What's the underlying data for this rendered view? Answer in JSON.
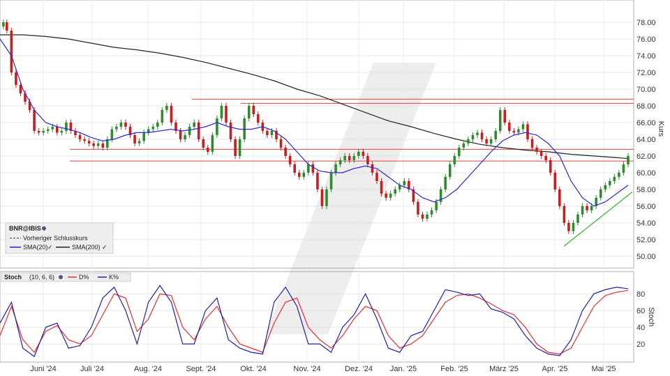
{
  "chart_data": [
    {
      "type": "candlestick",
      "symbol": "BNR@IBIS",
      "ylabel": "Kurs",
      "ylim": [
        49,
        80
      ],
      "y_ticks": [
        "78.00",
        "76.00",
        "74.00",
        "72.00",
        "70.00",
        "68.00",
        "66.00",
        "64.00",
        "62.00",
        "60.00",
        "58.00",
        "56.00",
        "54.00",
        "52.00",
        "50.00"
      ],
      "x_ticks": [
        "Juni '24",
        "Juli '24",
        "Aug. '24",
        "Sept. '24",
        "Okt. '24",
        "Nov. '24",
        "Dez. '24",
        "Jan. '25",
        "Feb. '25",
        "März '25",
        "Apr. '25",
        "Mai '25"
      ],
      "legend": {
        "symbol": "BNR@IBIS",
        "prev_close": "Vorheriger Schlusskurs",
        "sma20": "SMA(20)",
        "sma200": "SMA(200)"
      },
      "close_path": [
        [
          0,
          77.5
        ],
        [
          3,
          78
        ],
        [
          6,
          77
        ],
        [
          10,
          72
        ],
        [
          14,
          70.5
        ],
        [
          18,
          69.5
        ],
        [
          22,
          68.5
        ],
        [
          26,
          67.5
        ],
        [
          30,
          65
        ],
        [
          34,
          64.8
        ],
        [
          38,
          65
        ],
        [
          42,
          65.2
        ],
        [
          46,
          65.5
        ],
        [
          50,
          64.8
        ],
        [
          54,
          65
        ],
        [
          58,
          66
        ],
        [
          62,
          65
        ],
        [
          66,
          64.5
        ],
        [
          70,
          64
        ],
        [
          74,
          63.8
        ],
        [
          78,
          63.5
        ],
        [
          82,
          63.2
        ],
        [
          86,
          63.5
        ],
        [
          90,
          63
        ],
        [
          94,
          64
        ],
        [
          98,
          65.2
        ],
        [
          102,
          65.5
        ],
        [
          106,
          66
        ],
        [
          110,
          65.5
        ],
        [
          114,
          64.5
        ],
        [
          118,
          63.5
        ],
        [
          122,
          63.8
        ],
        [
          126,
          64.8
        ],
        [
          130,
          65.2
        ],
        [
          134,
          65.5
        ],
        [
          138,
          66
        ],
        [
          142,
          67.5
        ],
        [
          146,
          68
        ],
        [
          150,
          66
        ],
        [
          154,
          65
        ],
        [
          158,
          64
        ],
        [
          162,
          64.5
        ],
        [
          166,
          65.5
        ],
        [
          170,
          66
        ],
        [
          174,
          64
        ],
        [
          178,
          63
        ],
        [
          182,
          62.5
        ],
        [
          186,
          64.5
        ],
        [
          190,
          66.5
        ],
        [
          194,
          68
        ],
        [
          198,
          66
        ],
        [
          202,
          64
        ],
        [
          206,
          62
        ],
        [
          210,
          64
        ],
        [
          214,
          66.5
        ],
        [
          218,
          68
        ],
        [
          222,
          67
        ],
        [
          226,
          66
        ],
        [
          230,
          65
        ],
        [
          234,
          64.5
        ],
        [
          238,
          65
        ],
        [
          242,
          64
        ],
        [
          246,
          63
        ],
        [
          250,
          62
        ],
        [
          254,
          61
        ],
        [
          258,
          60
        ],
        [
          262,
          59.5
        ],
        [
          266,
          60
        ],
        [
          270,
          61
        ],
        [
          274,
          60
        ],
        [
          278,
          58
        ],
        [
          282,
          56
        ],
        [
          286,
          58
        ],
        [
          290,
          60
        ],
        [
          294,
          61
        ],
        [
          298,
          61.5
        ],
        [
          302,
          62
        ],
        [
          306,
          61.5
        ],
        [
          310,
          62
        ],
        [
          314,
          62.5
        ],
        [
          318,
          62
        ],
        [
          322,
          61
        ],
        [
          326,
          60
        ],
        [
          330,
          59
        ],
        [
          334,
          57.5
        ],
        [
          338,
          57
        ],
        [
          342,
          57.5
        ],
        [
          346,
          58
        ],
        [
          350,
          58.5
        ],
        [
          354,
          59
        ],
        [
          358,
          58
        ],
        [
          362,
          56.5
        ],
        [
          366,
          55
        ],
        [
          370,
          54.5
        ],
        [
          374,
          55
        ],
        [
          378,
          55.5
        ],
        [
          382,
          56.5
        ],
        [
          386,
          58
        ],
        [
          390,
          59.5
        ],
        [
          394,
          61
        ],
        [
          398,
          62
        ],
        [
          402,
          63
        ],
        [
          406,
          63.5
        ],
        [
          410,
          64
        ],
        [
          414,
          64.5
        ],
        [
          418,
          64.8
        ],
        [
          422,
          64
        ],
        [
          426,
          63.5
        ],
        [
          430,
          64
        ],
        [
          434,
          65
        ],
        [
          438,
          67.5
        ],
        [
          442,
          66
        ],
        [
          446,
          65
        ],
        [
          450,
          64.8
        ],
        [
          454,
          65.2
        ],
        [
          458,
          65.8
        ],
        [
          462,
          64
        ],
        [
          466,
          63
        ],
        [
          470,
          62.5
        ],
        [
          474,
          62
        ],
        [
          478,
          61.5
        ],
        [
          482,
          60
        ],
        [
          486,
          58
        ],
        [
          490,
          56
        ],
        [
          494,
          54
        ],
        [
          498,
          53
        ],
        [
          502,
          54
        ],
        [
          506,
          55
        ],
        [
          510,
          56
        ],
        [
          514,
          55.5
        ],
        [
          518,
          56
        ],
        [
          522,
          57
        ],
        [
          526,
          58
        ],
        [
          530,
          58.5
        ],
        [
          534,
          59
        ],
        [
          538,
          59.5
        ],
        [
          542,
          60
        ],
        [
          546,
          61
        ],
        [
          550,
          62
        ]
      ],
      "sma20": [
        [
          0,
          76
        ],
        [
          10,
          74
        ],
        [
          20,
          70
        ],
        [
          30,
          67.5
        ],
        [
          40,
          66
        ],
        [
          50,
          65.5
        ],
        [
          60,
          65.2
        ],
        [
          70,
          64.8
        ],
        [
          80,
          64.2
        ],
        [
          90,
          63.8
        ],
        [
          100,
          64
        ],
        [
          110,
          64.5
        ],
        [
          120,
          64.8
        ],
        [
          130,
          64.8
        ],
        [
          140,
          65
        ],
        [
          150,
          65.2
        ],
        [
          160,
          65
        ],
        [
          170,
          65.2
        ],
        [
          180,
          65.5
        ],
        [
          190,
          66
        ],
        [
          200,
          65.5
        ],
        [
          210,
          65.2
        ],
        [
          220,
          65.2
        ],
        [
          230,
          65.5
        ],
        [
          240,
          65
        ],
        [
          250,
          64
        ],
        [
          260,
          62.5
        ],
        [
          270,
          61
        ],
        [
          280,
          60.2
        ],
        [
          290,
          60
        ],
        [
          300,
          60
        ],
        [
          310,
          60.5
        ],
        [
          320,
          60.8
        ],
        [
          330,
          60.5
        ],
        [
          340,
          59.5
        ],
        [
          350,
          58.5
        ],
        [
          360,
          58
        ],
        [
          370,
          57
        ],
        [
          380,
          56.5
        ],
        [
          390,
          57
        ],
        [
          400,
          58
        ],
        [
          410,
          59.5
        ],
        [
          420,
          61
        ],
        [
          430,
          62.5
        ],
        [
          440,
          63.8
        ],
        [
          450,
          64.5
        ],
        [
          460,
          64.8
        ],
        [
          470,
          64.5
        ],
        [
          480,
          63.5
        ],
        [
          490,
          62
        ],
        [
          500,
          59
        ],
        [
          510,
          57
        ],
        [
          520,
          56
        ],
        [
          530,
          56.5
        ],
        [
          540,
          57.5
        ],
        [
          550,
          58.5
        ]
      ],
      "sma200": [
        [
          0,
          76.5
        ],
        [
          20,
          76.5
        ],
        [
          40,
          76.3
        ],
        [
          60,
          76
        ],
        [
          80,
          75.5
        ],
        [
          100,
          75
        ],
        [
          120,
          74.7
        ],
        [
          140,
          74.3
        ],
        [
          160,
          73.8
        ],
        [
          180,
          73.2
        ],
        [
          200,
          72.5
        ],
        [
          220,
          71.8
        ],
        [
          240,
          71
        ],
        [
          260,
          70
        ],
        [
          280,
          69.2
        ],
        [
          300,
          68.2
        ],
        [
          320,
          67.2
        ],
        [
          340,
          66.2
        ],
        [
          360,
          65.5
        ],
        [
          380,
          64.7
        ],
        [
          400,
          64
        ],
        [
          420,
          63.4
        ],
        [
          440,
          63
        ],
        [
          460,
          62.7
        ],
        [
          480,
          62.5
        ],
        [
          500,
          62.2
        ],
        [
          520,
          62
        ],
        [
          540,
          61.8
        ],
        [
          550,
          61.7
        ]
      ],
      "horizontal_levels": [
        68.8,
        68.3,
        62.8,
        61.4
      ],
      "trendline": [
        [
          51.2,
          52
        ],
        [
          57.7,
          58
        ]
      ]
    },
    {
      "type": "line",
      "indicator": "Stoch",
      "params": "(10, 6, 6)",
      "ylabel": "Stoch",
      "ylim": [
        0,
        100
      ],
      "y_ticks": [
        "80",
        "60",
        "40",
        "20"
      ],
      "series": [
        {
          "name": "D%",
          "color": "#e03030"
        },
        {
          "name": "K%",
          "color": "#2020a0"
        }
      ],
      "d_values": [
        [
          0,
          30
        ],
        [
          10,
          65
        ],
        [
          20,
          25
        ],
        [
          30,
          10
        ],
        [
          40,
          35
        ],
        [
          50,
          42
        ],
        [
          60,
          25
        ],
        [
          70,
          20
        ],
        [
          80,
          30
        ],
        [
          90,
          55
        ],
        [
          100,
          80
        ],
        [
          110,
          75
        ],
        [
          120,
          35
        ],
        [
          130,
          50
        ],
        [
          140,
          80
        ],
        [
          150,
          78
        ],
        [
          160,
          40
        ],
        [
          170,
          25
        ],
        [
          180,
          50
        ],
        [
          190,
          65
        ],
        [
          200,
          40
        ],
        [
          210,
          20
        ],
        [
          220,
          15
        ],
        [
          230,
          10
        ],
        [
          240,
          45
        ],
        [
          250,
          70
        ],
        [
          260,
          75
        ],
        [
          270,
          40
        ],
        [
          280,
          25
        ],
        [
          290,
          15
        ],
        [
          300,
          30
        ],
        [
          310,
          50
        ],
        [
          320,
          65
        ],
        [
          330,
          60
        ],
        [
          340,
          30
        ],
        [
          350,
          15
        ],
        [
          360,
          20
        ],
        [
          370,
          30
        ],
        [
          380,
          50
        ],
        [
          390,
          70
        ],
        [
          400,
          78
        ],
        [
          410,
          80
        ],
        [
          420,
          75
        ],
        [
          430,
          68
        ],
        [
          440,
          60
        ],
        [
          450,
          55
        ],
        [
          460,
          40
        ],
        [
          470,
          20
        ],
        [
          480,
          10
        ],
        [
          490,
          8
        ],
        [
          500,
          15
        ],
        [
          510,
          40
        ],
        [
          520,
          65
        ],
        [
          530,
          78
        ],
        [
          540,
          82
        ],
        [
          550,
          84
        ]
      ],
      "k_values": [
        [
          0,
          45
        ],
        [
          10,
          70
        ],
        [
          20,
          15
        ],
        [
          30,
          5
        ],
        [
          40,
          40
        ],
        [
          50,
          45
        ],
        [
          60,
          15
        ],
        [
          70,
          18
        ],
        [
          80,
          40
        ],
        [
          90,
          75
        ],
        [
          100,
          88
        ],
        [
          110,
          60
        ],
        [
          120,
          20
        ],
        [
          130,
          70
        ],
        [
          140,
          90
        ],
        [
          150,
          70
        ],
        [
          160,
          20
        ],
        [
          170,
          20
        ],
        [
          180,
          60
        ],
        [
          190,
          75
        ],
        [
          200,
          25
        ],
        [
          210,
          15
        ],
        [
          220,
          10
        ],
        [
          230,
          8
        ],
        [
          240,
          70
        ],
        [
          250,
          88
        ],
        [
          260,
          65
        ],
        [
          270,
          20
        ],
        [
          280,
          20
        ],
        [
          290,
          10
        ],
        [
          300,
          40
        ],
        [
          310,
          55
        ],
        [
          320,
          80
        ],
        [
          330,
          50
        ],
        [
          340,
          15
        ],
        [
          350,
          10
        ],
        [
          360,
          30
        ],
        [
          370,
          35
        ],
        [
          380,
          60
        ],
        [
          390,
          85
        ],
        [
          400,
          82
        ],
        [
          410,
          78
        ],
        [
          420,
          80
        ],
        [
          430,
          62
        ],
        [
          440,
          58
        ],
        [
          450,
          50
        ],
        [
          460,
          30
        ],
        [
          470,
          15
        ],
        [
          480,
          8
        ],
        [
          490,
          6
        ],
        [
          500,
          25
        ],
        [
          510,
          60
        ],
        [
          520,
          80
        ],
        [
          530,
          85
        ],
        [
          540,
          88
        ],
        [
          550,
          86
        ]
      ]
    }
  ]
}
